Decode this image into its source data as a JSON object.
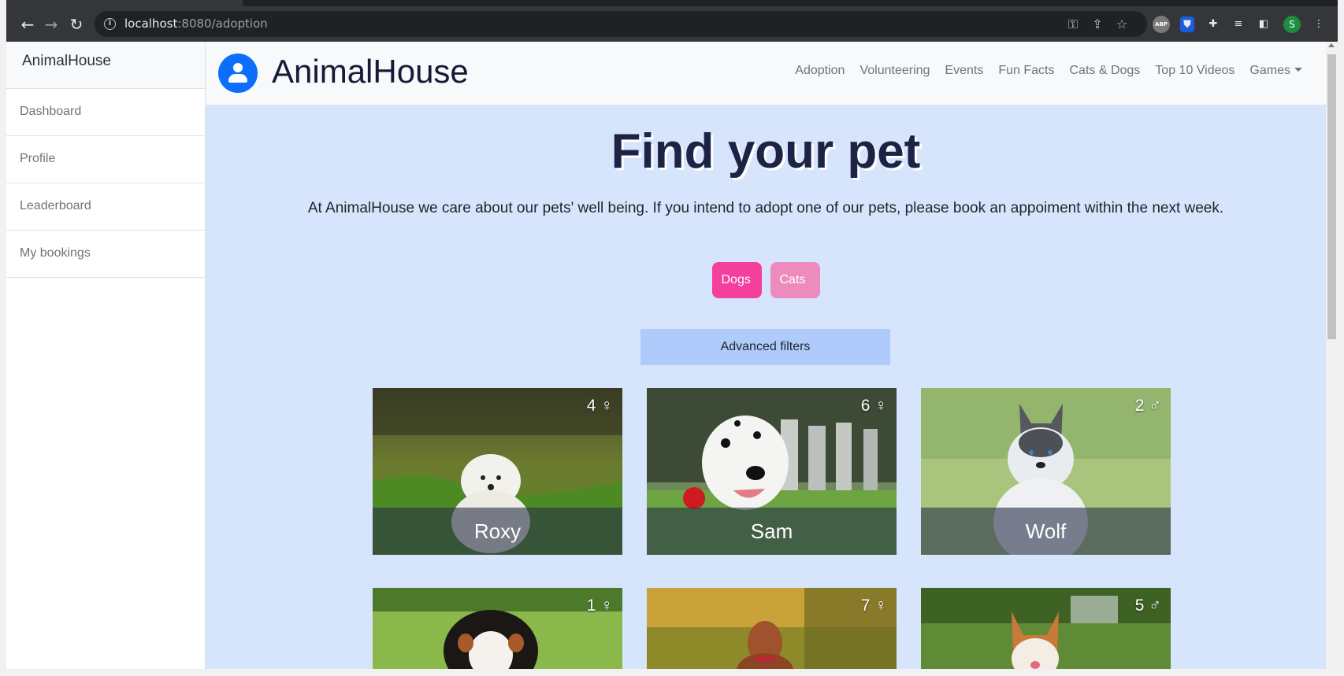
{
  "browser": {
    "url_host": "localhost",
    "url_rest": ":8080/adoption",
    "extension_abp_label": "ABP",
    "profile_initial": "S"
  },
  "sidebar": {
    "brand": "AnimalHouse",
    "items": [
      {
        "label": "Dashboard"
      },
      {
        "label": "Profile"
      },
      {
        "label": "Leaderboard"
      },
      {
        "label": "My bookings"
      }
    ]
  },
  "navbar": {
    "title": "AnimalHouse",
    "links": [
      {
        "label": "Adoption"
      },
      {
        "label": "Volunteering"
      },
      {
        "label": "Events"
      },
      {
        "label": "Fun Facts"
      },
      {
        "label": "Cats & Dogs"
      },
      {
        "label": "Top 10 Videos"
      },
      {
        "label": "Games"
      }
    ]
  },
  "page": {
    "heading": "Find your pet",
    "lead": "At AnimalHouse we care about our pets' well being. If you intend to adopt one of our pets, please book an appoiment within the next week.",
    "dogs_button": "Dogs",
    "cats_button": "Cats",
    "filters_button": "Advanced filters"
  },
  "pets": [
    {
      "name": "Roxy",
      "age": "4 ♀"
    },
    {
      "name": "Sam",
      "age": "6 ♀"
    },
    {
      "name": "Wolf",
      "age": "2 ♂"
    },
    {
      "name": "",
      "age": "1 ♀"
    },
    {
      "name": "",
      "age": "7 ♀"
    },
    {
      "name": "",
      "age": "5 ♂"
    }
  ],
  "colors": {
    "accent": "#0d6efd",
    "dogs_button": "#f43f9d",
    "cats_button": "#ed8cbc",
    "page_background": "#d6e4fc"
  }
}
